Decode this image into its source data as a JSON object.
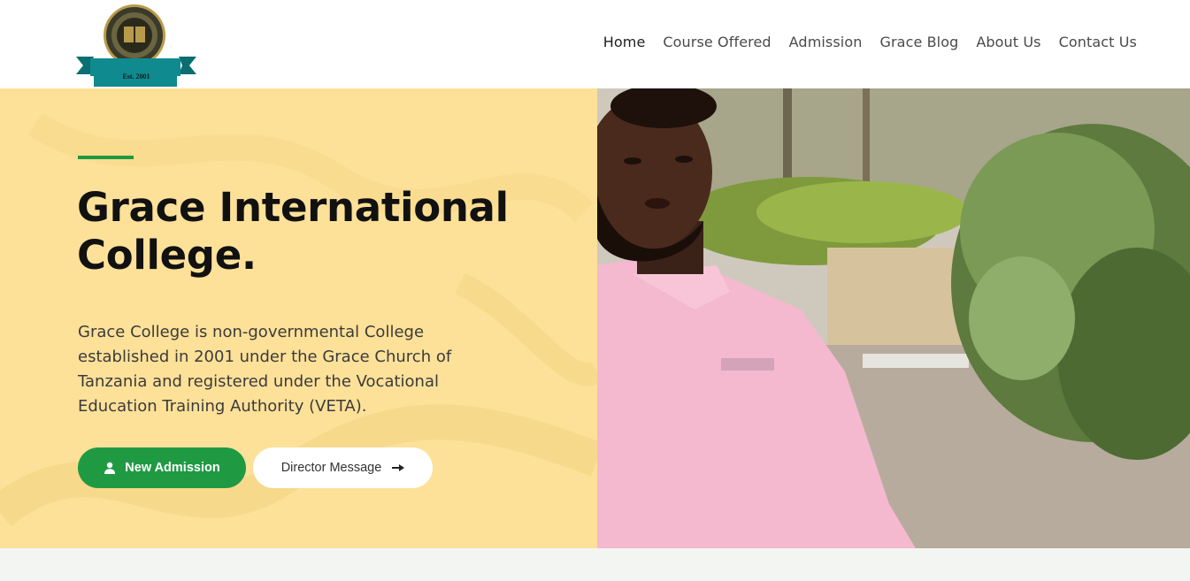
{
  "brand": {
    "logo_alt": "Grace International College crest",
    "established": "Est. 2001",
    "colors": {
      "seal": "#3a3a2a",
      "ribbon": "#0f8a8f",
      "gold": "#b89b4a"
    }
  },
  "nav": {
    "items": [
      {
        "label": "Home",
        "active": true
      },
      {
        "label": "Course Offered",
        "active": false
      },
      {
        "label": "Admission",
        "active": false
      },
      {
        "label": "Grace Blog",
        "active": false
      },
      {
        "label": "About Us",
        "active": false
      },
      {
        "label": "Contact Us",
        "active": false
      }
    ]
  },
  "hero": {
    "title_line1": "Grace International",
    "title_line2": "College.",
    "description": "Grace College is non-governmental College established in 2001 under the Grace Church of Tanzania and registered under the Vocational Education Training Authority (VETA).",
    "primary_button": {
      "label": "New Admission",
      "icon": "user-icon"
    },
    "secondary_button": {
      "label": "Director Message",
      "icon": "arrow-right-icon"
    },
    "colors": {
      "panel": "#fde199",
      "accent": "#1d9a3e",
      "button_primary": "#1f9a43"
    }
  },
  "media": {
    "photo_alt": "Director speaking outdoors in front of garden shrubs"
  }
}
